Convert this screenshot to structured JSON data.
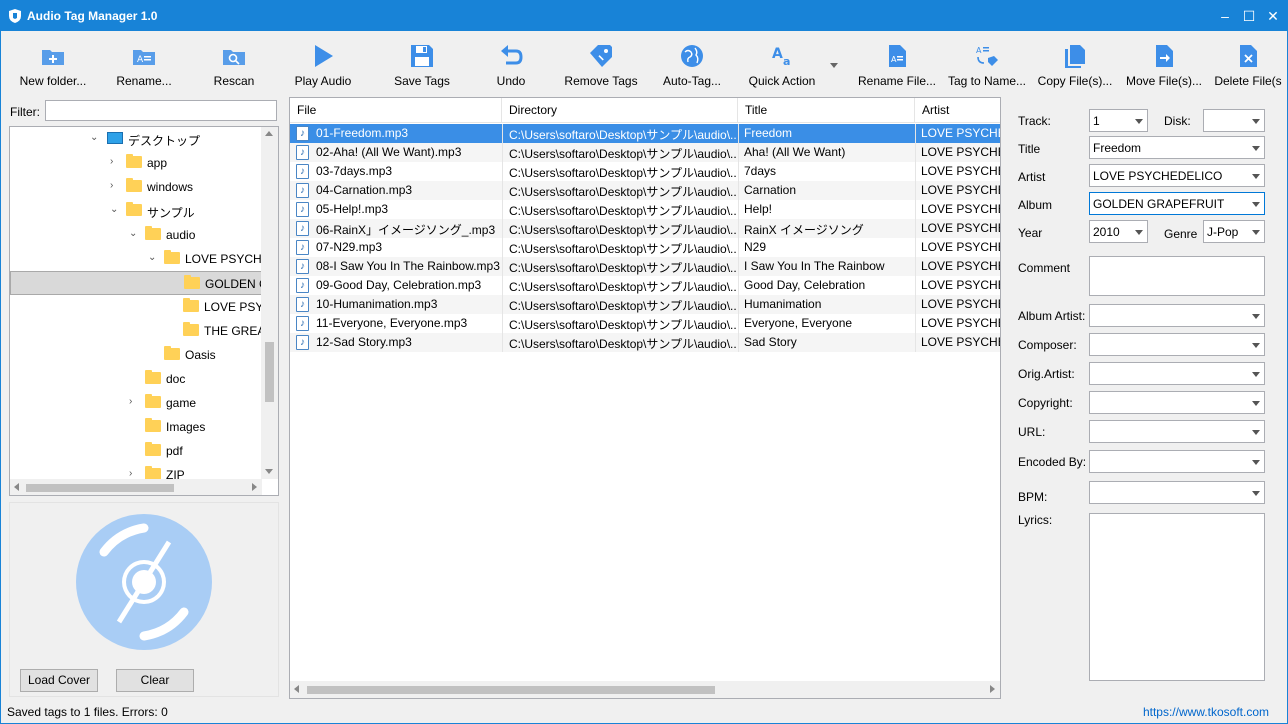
{
  "window": {
    "title": "Audio Tag Manager 1.0",
    "min": "–",
    "max": "☐",
    "close": "✕"
  },
  "toolbar": {
    "new_folder": "New folder...",
    "rename": "Rename...",
    "rescan": "Rescan",
    "play_audio": "Play Audio",
    "save_tags": "Save Tags",
    "undo": "Undo",
    "remove_tags": "Remove Tags",
    "auto_tag": "Auto-Tag...",
    "quick_action": "Quick Action",
    "rename_file": "Rename File...",
    "tag_to_name": "Tag to Name...",
    "copy_files": "Copy File(s)...",
    "move_files": "Move File(s)...",
    "delete_files": "Delete File(s"
  },
  "left": {
    "filter_label": "Filter:",
    "filter_value": "",
    "tree": [
      {
        "label": "デスクトップ",
        "kind": "desktop",
        "expanded": true
      },
      {
        "label": "app",
        "kind": "folder",
        "expanded": false
      },
      {
        "label": "windows",
        "kind": "folder",
        "expanded": false
      },
      {
        "label": "サンプル",
        "kind": "folder",
        "expanded": true
      },
      {
        "label": "audio",
        "kind": "folder",
        "expanded": true
      },
      {
        "label": "LOVE PSYCHEDELICO",
        "kind": "folder",
        "expanded": true
      },
      {
        "label": "GOLDEN GRAPEFRUIT",
        "kind": "folder",
        "selected": true
      },
      {
        "label": "LOVE PSYCHEDELICO",
        "kind": "folder"
      },
      {
        "label": "THE GREATEST HITS",
        "kind": "folder"
      },
      {
        "label": "Oasis",
        "kind": "folder"
      },
      {
        "label": "doc",
        "kind": "folder"
      },
      {
        "label": "game",
        "kind": "folder",
        "expanded": false
      },
      {
        "label": "Images",
        "kind": "folder"
      },
      {
        "label": "pdf",
        "kind": "folder"
      },
      {
        "label": "ZIP",
        "kind": "folder",
        "expanded": false
      }
    ],
    "load_cover": "Load Cover",
    "clear": "Clear"
  },
  "grid": {
    "columns": [
      "File",
      "Directory",
      "Title",
      "Artist"
    ],
    "rows": [
      {
        "file": "01-Freedom.mp3",
        "dir": "C:\\Users\\softaro\\Desktop\\サンプル\\audio\\...",
        "title": "Freedom",
        "artist": "LOVE PSYCHEDELICO"
      },
      {
        "file": "02-Aha! (All We Want).mp3",
        "dir": "C:\\Users\\softaro\\Desktop\\サンプル\\audio\\...",
        "title": "Aha! (All We Want)",
        "artist": "LOVE PSYCHEDELICO"
      },
      {
        "file": "03-7days.mp3",
        "dir": "C:\\Users\\softaro\\Desktop\\サンプル\\audio\\...",
        "title": "7days",
        "artist": "LOVE PSYCHEDELICO"
      },
      {
        "file": "04-Carnation.mp3",
        "dir": "C:\\Users\\softaro\\Desktop\\サンプル\\audio\\...",
        "title": "Carnation",
        "artist": "LOVE PSYCHEDELICO"
      },
      {
        "file": "05-Help!.mp3",
        "dir": "C:\\Users\\softaro\\Desktop\\サンプル\\audio\\...",
        "title": "Help!",
        "artist": "LOVE PSYCHEDELICO"
      },
      {
        "file": "06-RainX」イメージソング_.mp3",
        "dir": "C:\\Users\\softaro\\Desktop\\サンプル\\audio\\...",
        "title": "RainX イメージソング",
        "artist": "LOVE PSYCHEDELICO"
      },
      {
        "file": "07-N29.mp3",
        "dir": "C:\\Users\\softaro\\Desktop\\サンプル\\audio\\...",
        "title": "N29",
        "artist": "LOVE PSYCHEDELICO"
      },
      {
        "file": "08-I Saw You In The Rainbow.mp3",
        "dir": "C:\\Users\\softaro\\Desktop\\サンプル\\audio\\...",
        "title": "I Saw You In The Rainbow",
        "artist": "LOVE PSYCHEDELICO"
      },
      {
        "file": "09-Good Day, Celebration.mp3",
        "dir": "C:\\Users\\softaro\\Desktop\\サンプル\\audio\\...",
        "title": "Good Day, Celebration",
        "artist": "LOVE PSYCHEDELICO"
      },
      {
        "file": "10-Humanimation.mp3",
        "dir": "C:\\Users\\softaro\\Desktop\\サンプル\\audio\\...",
        "title": "Humanimation",
        "artist": "LOVE PSYCHEDELICO"
      },
      {
        "file": "11-Everyone, Everyone.mp3",
        "dir": "C:\\Users\\softaro\\Desktop\\サンプル\\audio\\...",
        "title": "Everyone, Everyone",
        "artist": "LOVE PSYCHEDELICO"
      },
      {
        "file": "12-Sad Story.mp3",
        "dir": "C:\\Users\\softaro\\Desktop\\サンプル\\audio\\...",
        "title": "Sad Story",
        "artist": "LOVE PSYCHEDELICO"
      }
    ]
  },
  "tags": {
    "track_label": "Track:",
    "track": "1",
    "disk_label": "Disk:",
    "disk": "",
    "title_label": "Title",
    "title": "Freedom",
    "artist_label": "Artist",
    "artist": "LOVE PSYCHEDELICO",
    "album_label": "Album",
    "album": "GOLDEN GRAPEFRUIT",
    "year_label": "Year",
    "year": "2010",
    "genre_label": "Genre",
    "genre": "J-Pop",
    "comment_label": "Comment",
    "album_artist_label": "Album Artist:",
    "composer_label": "Composer:",
    "orig_artist_label": "Orig.Artist:",
    "copyright_label": "Copyright:",
    "url_label": "URL:",
    "encoded_by_label": "Encoded By:",
    "bpm_label": "BPM:",
    "lyrics_label": "Lyrics:"
  },
  "status": {
    "message": "Saved tags to 1 files. Errors: 0",
    "link": "https://www.tkosoft.com"
  },
  "colors": {
    "accent": "#1883d7",
    "icon_blue": "#3d8ee8",
    "selection": "#3a8ee6"
  }
}
